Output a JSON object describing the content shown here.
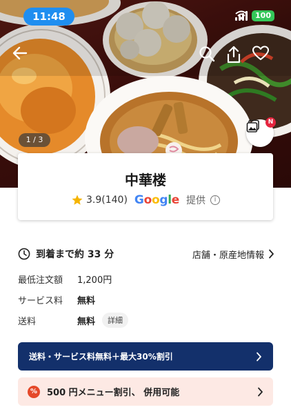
{
  "status_bar": {
    "time": "11:48",
    "battery": "100"
  },
  "hero": {
    "pager": "1 / 3",
    "gallery_badge": "N"
  },
  "store": {
    "name": "中華楼",
    "rating": "3.9(140)",
    "rating_source": "Google",
    "provided_label": "提供",
    "info_symbol": "i"
  },
  "delivery": {
    "eta": "到着まで約 33 分",
    "store_info_link": "店舗・原産地情報"
  },
  "fees": {
    "min_order_label": "最低注文額",
    "min_order_value": "1,200円",
    "service_fee_label": "サービス料",
    "service_fee_value": "無料",
    "delivery_fee_label": "送料",
    "delivery_fee_value": "無料",
    "detail_button": "詳細"
  },
  "promos": {
    "navy_text": "送料・サービス料無料＋最大30%割引",
    "pink_badge": "%",
    "pink_text": "500 円メニュー割引、 併用可能"
  },
  "colors": {
    "accent_blue": "#1f8ef0",
    "promo_navy": "#13306b",
    "promo_pink": "#fde9e4",
    "star": "#f5b400"
  }
}
